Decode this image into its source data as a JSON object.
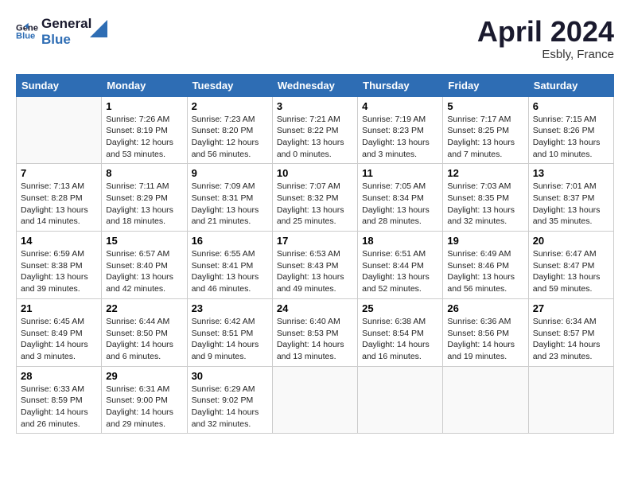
{
  "header": {
    "logo_line1": "General",
    "logo_line2": "Blue",
    "month_title": "April 2024",
    "subtitle": "Esbly, France"
  },
  "days_of_week": [
    "Sunday",
    "Monday",
    "Tuesday",
    "Wednesday",
    "Thursday",
    "Friday",
    "Saturday"
  ],
  "weeks": [
    [
      {
        "num": "",
        "info": ""
      },
      {
        "num": "1",
        "info": "Sunrise: 7:26 AM\nSunset: 8:19 PM\nDaylight: 12 hours\nand 53 minutes."
      },
      {
        "num": "2",
        "info": "Sunrise: 7:23 AM\nSunset: 8:20 PM\nDaylight: 12 hours\nand 56 minutes."
      },
      {
        "num": "3",
        "info": "Sunrise: 7:21 AM\nSunset: 8:22 PM\nDaylight: 13 hours\nand 0 minutes."
      },
      {
        "num": "4",
        "info": "Sunrise: 7:19 AM\nSunset: 8:23 PM\nDaylight: 13 hours\nand 3 minutes."
      },
      {
        "num": "5",
        "info": "Sunrise: 7:17 AM\nSunset: 8:25 PM\nDaylight: 13 hours\nand 7 minutes."
      },
      {
        "num": "6",
        "info": "Sunrise: 7:15 AM\nSunset: 8:26 PM\nDaylight: 13 hours\nand 10 minutes."
      }
    ],
    [
      {
        "num": "7",
        "info": "Sunrise: 7:13 AM\nSunset: 8:28 PM\nDaylight: 13 hours\nand 14 minutes."
      },
      {
        "num": "8",
        "info": "Sunrise: 7:11 AM\nSunset: 8:29 PM\nDaylight: 13 hours\nand 18 minutes."
      },
      {
        "num": "9",
        "info": "Sunrise: 7:09 AM\nSunset: 8:31 PM\nDaylight: 13 hours\nand 21 minutes."
      },
      {
        "num": "10",
        "info": "Sunrise: 7:07 AM\nSunset: 8:32 PM\nDaylight: 13 hours\nand 25 minutes."
      },
      {
        "num": "11",
        "info": "Sunrise: 7:05 AM\nSunset: 8:34 PM\nDaylight: 13 hours\nand 28 minutes."
      },
      {
        "num": "12",
        "info": "Sunrise: 7:03 AM\nSunset: 8:35 PM\nDaylight: 13 hours\nand 32 minutes."
      },
      {
        "num": "13",
        "info": "Sunrise: 7:01 AM\nSunset: 8:37 PM\nDaylight: 13 hours\nand 35 minutes."
      }
    ],
    [
      {
        "num": "14",
        "info": "Sunrise: 6:59 AM\nSunset: 8:38 PM\nDaylight: 13 hours\nand 39 minutes."
      },
      {
        "num": "15",
        "info": "Sunrise: 6:57 AM\nSunset: 8:40 PM\nDaylight: 13 hours\nand 42 minutes."
      },
      {
        "num": "16",
        "info": "Sunrise: 6:55 AM\nSunset: 8:41 PM\nDaylight: 13 hours\nand 46 minutes."
      },
      {
        "num": "17",
        "info": "Sunrise: 6:53 AM\nSunset: 8:43 PM\nDaylight: 13 hours\nand 49 minutes."
      },
      {
        "num": "18",
        "info": "Sunrise: 6:51 AM\nSunset: 8:44 PM\nDaylight: 13 hours\nand 52 minutes."
      },
      {
        "num": "19",
        "info": "Sunrise: 6:49 AM\nSunset: 8:46 PM\nDaylight: 13 hours\nand 56 minutes."
      },
      {
        "num": "20",
        "info": "Sunrise: 6:47 AM\nSunset: 8:47 PM\nDaylight: 13 hours\nand 59 minutes."
      }
    ],
    [
      {
        "num": "21",
        "info": "Sunrise: 6:45 AM\nSunset: 8:49 PM\nDaylight: 14 hours\nand 3 minutes."
      },
      {
        "num": "22",
        "info": "Sunrise: 6:44 AM\nSunset: 8:50 PM\nDaylight: 14 hours\nand 6 minutes."
      },
      {
        "num": "23",
        "info": "Sunrise: 6:42 AM\nSunset: 8:51 PM\nDaylight: 14 hours\nand 9 minutes."
      },
      {
        "num": "24",
        "info": "Sunrise: 6:40 AM\nSunset: 8:53 PM\nDaylight: 14 hours\nand 13 minutes."
      },
      {
        "num": "25",
        "info": "Sunrise: 6:38 AM\nSunset: 8:54 PM\nDaylight: 14 hours\nand 16 minutes."
      },
      {
        "num": "26",
        "info": "Sunrise: 6:36 AM\nSunset: 8:56 PM\nDaylight: 14 hours\nand 19 minutes."
      },
      {
        "num": "27",
        "info": "Sunrise: 6:34 AM\nSunset: 8:57 PM\nDaylight: 14 hours\nand 23 minutes."
      }
    ],
    [
      {
        "num": "28",
        "info": "Sunrise: 6:33 AM\nSunset: 8:59 PM\nDaylight: 14 hours\nand 26 minutes."
      },
      {
        "num": "29",
        "info": "Sunrise: 6:31 AM\nSunset: 9:00 PM\nDaylight: 14 hours\nand 29 minutes."
      },
      {
        "num": "30",
        "info": "Sunrise: 6:29 AM\nSunset: 9:02 PM\nDaylight: 14 hours\nand 32 minutes."
      },
      {
        "num": "",
        "info": ""
      },
      {
        "num": "",
        "info": ""
      },
      {
        "num": "",
        "info": ""
      },
      {
        "num": "",
        "info": ""
      }
    ]
  ]
}
